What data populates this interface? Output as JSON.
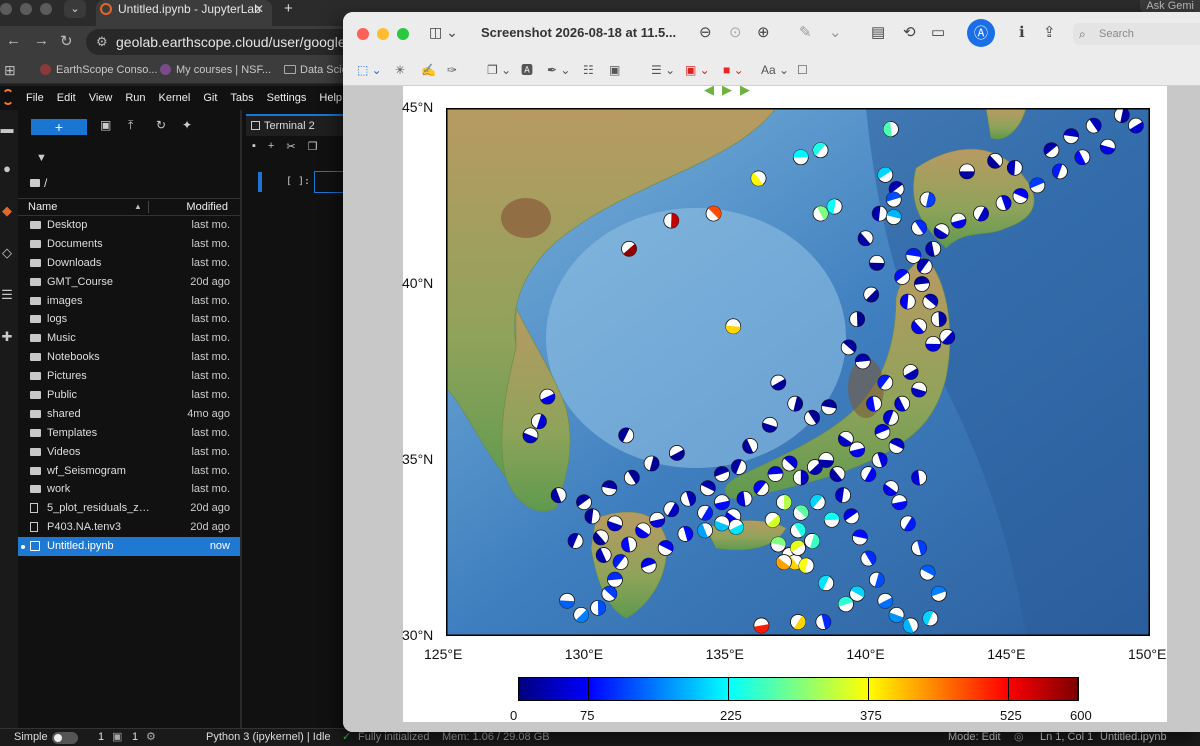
{
  "browser": {
    "tab_title": "Untitled.ipynb - JupyterLab",
    "url": "geolab.earthscope.cloud/user/google-oauth",
    "ask": "Ask Gemi",
    "bookmarks": [
      {
        "label": "EarthScope Conso..."
      },
      {
        "label": "My courses | NSF..."
      },
      {
        "label": "Data Scie"
      }
    ]
  },
  "jupyter": {
    "menu": [
      "File",
      "Edit",
      "View",
      "Run",
      "Kernel",
      "Git",
      "Tabs",
      "Settings",
      "Help"
    ],
    "new_label": "+",
    "crumb": "/",
    "col_name": "Name",
    "col_modified": "Modified",
    "files": [
      {
        "name": "Desktop",
        "modified": "last mo.",
        "type": "folder"
      },
      {
        "name": "Documents",
        "modified": "last mo.",
        "type": "folder"
      },
      {
        "name": "Downloads",
        "modified": "last mo.",
        "type": "folder"
      },
      {
        "name": "GMT_Course",
        "modified": "20d ago",
        "type": "folder"
      },
      {
        "name": "images",
        "modified": "last mo.",
        "type": "folder"
      },
      {
        "name": "logs",
        "modified": "last mo.",
        "type": "folder"
      },
      {
        "name": "Music",
        "modified": "last mo.",
        "type": "folder"
      },
      {
        "name": "Notebooks",
        "modified": "last mo.",
        "type": "folder"
      },
      {
        "name": "Pictures",
        "modified": "last mo.",
        "type": "folder"
      },
      {
        "name": "Public",
        "modified": "last mo.",
        "type": "folder"
      },
      {
        "name": "shared",
        "modified": "4mo ago",
        "type": "folder"
      },
      {
        "name": "Templates",
        "modified": "last mo.",
        "type": "folder"
      },
      {
        "name": "Videos",
        "modified": "last mo.",
        "type": "folder"
      },
      {
        "name": "wf_Seismogram",
        "modified": "last mo.",
        "type": "folder"
      },
      {
        "name": "work",
        "modified": "last mo.",
        "type": "folder"
      },
      {
        "name": "5_plot_residuals_zo...",
        "modified": "20d ago",
        "type": "file"
      },
      {
        "name": "P403.NA.tenv3",
        "modified": "20d ago",
        "type": "file"
      },
      {
        "name": "Untitled.ipynb",
        "modified": "now",
        "type": "notebook",
        "selected": true
      }
    ],
    "tab_label": "Terminal 2",
    "cell_prompt": "[ ]:"
  },
  "status": {
    "mode_label": "Simple",
    "count1": "1",
    "count2": "1",
    "kernel": "Python 3 (ipykernel) | Idle",
    "init": "Fully initialized",
    "mem": "Mem: 1.06 / 29.08 GB",
    "edit_mode": "Mode: Edit",
    "position": "Ln 1, Col 1",
    "filename": "Untitled.ipynb"
  },
  "preview": {
    "title": "Screenshot 2026-08-18 at 11.5...",
    "search_placeholder": "Search",
    "traffic_colors": [
      "#fe5f57",
      "#febc2e",
      "#28c840"
    ]
  },
  "chart_data": {
    "type": "scatter",
    "title": "",
    "xlim": [
      125,
      150
    ],
    "ylim": [
      30,
      45
    ],
    "x_ticks": [
      "125°E",
      "130°E",
      "135°E",
      "140°E",
      "145°E",
      "150°E"
    ],
    "y_ticks": [
      "30°N",
      "35°N",
      "40°N",
      "45°N"
    ],
    "colorbar": {
      "ticks": [
        "0",
        "75",
        "225",
        "375",
        "525",
        "600"
      ],
      "range": [
        0,
        600
      ],
      "colormap": "jet"
    },
    "series": [
      {
        "points": [
          [
            143.5,
            43.2,
            20
          ],
          [
            144.5,
            43.5,
            15
          ],
          [
            145.2,
            43.3,
            30
          ],
          [
            146.5,
            43.8,
            25
          ],
          [
            147.2,
            44.2,
            40
          ],
          [
            148.0,
            44.5,
            35
          ],
          [
            149.0,
            44.8,
            20
          ],
          [
            149.5,
            44.5,
            45
          ],
          [
            148.5,
            43.9,
            60
          ],
          [
            147.6,
            43.6,
            80
          ],
          [
            146.8,
            43.2,
            90
          ],
          [
            146.0,
            42.8,
            110
          ],
          [
            145.4,
            42.5,
            70
          ],
          [
            144.8,
            42.3,
            50
          ],
          [
            144.0,
            42.0,
            40
          ],
          [
            143.2,
            41.8,
            60
          ],
          [
            142.6,
            41.5,
            35
          ],
          [
            142.3,
            41.0,
            25
          ],
          [
            142.0,
            40.5,
            30
          ],
          [
            141.9,
            40.0,
            20
          ],
          [
            142.2,
            39.5,
            30
          ],
          [
            142.5,
            39.0,
            25
          ],
          [
            142.8,
            38.5,
            40
          ],
          [
            142.3,
            38.3,
            50
          ],
          [
            141.8,
            38.8,
            60
          ],
          [
            141.4,
            39.5,
            70
          ],
          [
            141.2,
            40.2,
            80
          ],
          [
            141.6,
            40.8,
            90
          ],
          [
            141.8,
            41.6,
            100
          ],
          [
            142.1,
            42.4,
            110
          ],
          [
            141.5,
            37.5,
            30
          ],
          [
            141.8,
            37.0,
            35
          ],
          [
            141.2,
            36.6,
            45
          ],
          [
            140.8,
            36.2,
            50
          ],
          [
            140.5,
            35.8,
            60
          ],
          [
            141.0,
            35.4,
            40
          ],
          [
            140.4,
            35.0,
            55
          ],
          [
            140.0,
            34.6,
            70
          ],
          [
            139.6,
            35.3,
            65
          ],
          [
            139.2,
            35.6,
            40
          ],
          [
            140.2,
            36.6,
            80
          ],
          [
            140.6,
            37.2,
            90
          ],
          [
            139.8,
            37.8,
            20
          ],
          [
            139.3,
            38.2,
            15
          ],
          [
            139.6,
            39.0,
            10
          ],
          [
            140.1,
            39.7,
            12
          ],
          [
            140.3,
            40.6,
            15
          ],
          [
            139.9,
            41.3,
            20
          ],
          [
            140.4,
            42.0,
            25
          ],
          [
            141.0,
            42.7,
            30
          ],
          [
            138.6,
            36.5,
            15
          ],
          [
            138.0,
            36.2,
            10
          ],
          [
            137.4,
            36.6,
            12
          ],
          [
            136.8,
            37.2,
            15
          ],
          [
            136.5,
            36.0,
            20
          ],
          [
            135.8,
            35.4,
            14
          ],
          [
            135.4,
            34.8,
            18
          ],
          [
            134.8,
            34.6,
            20
          ],
          [
            134.3,
            34.2,
            25
          ],
          [
            133.6,
            33.9,
            30
          ],
          [
            133.0,
            33.6,
            40
          ],
          [
            132.5,
            33.3,
            50
          ],
          [
            132.0,
            33.0,
            60
          ],
          [
            131.5,
            32.6,
            80
          ],
          [
            131.2,
            32.1,
            90
          ],
          [
            131.0,
            31.6,
            100
          ],
          [
            130.8,
            31.2,
            110
          ],
          [
            130.4,
            30.8,
            120
          ],
          [
            129.8,
            30.6,
            150
          ],
          [
            129.3,
            31.0,
            130
          ],
          [
            130.5,
            32.8,
            15
          ],
          [
            130.2,
            33.4,
            12
          ],
          [
            129.9,
            33.8,
            20
          ],
          [
            130.8,
            34.2,
            18
          ],
          [
            131.6,
            34.5,
            14
          ],
          [
            132.3,
            34.9,
            12
          ],
          [
            133.2,
            35.2,
            15
          ],
          [
            131.0,
            33.2,
            40
          ],
          [
            130.6,
            32.3,
            30
          ],
          [
            129.6,
            32.7,
            25
          ],
          [
            132.2,
            32.0,
            60
          ],
          [
            132.8,
            32.5,
            70
          ],
          [
            133.5,
            32.9,
            80
          ],
          [
            134.2,
            33.5,
            90
          ],
          [
            134.8,
            33.8,
            80
          ],
          [
            135.2,
            33.4,
            60
          ],
          [
            135.6,
            33.9,
            50
          ],
          [
            136.2,
            34.2,
            70
          ],
          [
            136.7,
            34.6,
            60
          ],
          [
            137.2,
            34.9,
            50
          ],
          [
            137.6,
            34.5,
            40
          ],
          [
            138.1,
            34.8,
            30
          ],
          [
            138.5,
            35.0,
            25
          ],
          [
            138.9,
            34.6,
            20
          ],
          [
            139.1,
            34.0,
            40
          ],
          [
            139.4,
            33.4,
            60
          ],
          [
            139.7,
            32.8,
            80
          ],
          [
            140.0,
            32.2,
            100
          ],
          [
            140.3,
            31.6,
            120
          ],
          [
            140.6,
            31.0,
            140
          ],
          [
            141.0,
            30.6,
            160
          ],
          [
            141.5,
            30.3,
            180
          ],
          [
            142.2,
            30.5,
            200
          ],
          [
            142.5,
            31.2,
            150
          ],
          [
            142.1,
            31.8,
            130
          ],
          [
            141.8,
            32.5,
            110
          ],
          [
            141.4,
            33.2,
            90
          ],
          [
            141.1,
            33.8,
            80
          ],
          [
            140.8,
            34.2,
            60
          ],
          [
            141.8,
            34.5,
            50
          ],
          [
            138.2,
            33.8,
            200
          ],
          [
            138.7,
            33.3,
            230
          ],
          [
            137.6,
            33.5,
            280
          ],
          [
            137.0,
            33.8,
            330
          ],
          [
            136.6,
            33.3,
            350
          ],
          [
            137.2,
            32.3,
            390
          ],
          [
            137.4,
            32.1,
            400
          ],
          [
            137.8,
            32.0,
            370
          ],
          [
            137.5,
            32.5,
            360
          ],
          [
            136.8,
            32.6,
            300
          ],
          [
            137.5,
            33.0,
            240
          ],
          [
            138.0,
            32.7,
            260
          ],
          [
            135.3,
            33.1,
            210
          ],
          [
            134.8,
            33.2,
            190
          ],
          [
            134.2,
            33.0,
            170
          ],
          [
            138.5,
            31.5,
            210
          ],
          [
            139.2,
            30.9,
            250
          ],
          [
            139.6,
            31.2,
            200
          ],
          [
            138.4,
            30.4,
            100
          ],
          [
            137.5,
            30.4,
            400
          ],
          [
            136.2,
            30.3,
            510
          ],
          [
            137.0,
            32.1,
            430
          ],
          [
            140.8,
            44.4,
            270
          ],
          [
            138.3,
            43.8,
            240
          ],
          [
            137.6,
            43.6,
            220
          ],
          [
            134.5,
            42.0,
            480
          ],
          [
            133.0,
            41.8,
            560
          ],
          [
            131.5,
            41.0,
            590
          ],
          [
            135.2,
            38.8,
            400
          ],
          [
            136.1,
            43.0,
            380
          ],
          [
            138.8,
            42.2,
            230
          ],
          [
            140.6,
            43.1,
            200
          ],
          [
            140.9,
            41.9,
            180
          ],
          [
            138.3,
            42.0,
            300
          ],
          [
            128.3,
            36.1,
            50
          ],
          [
            128.6,
            36.8,
            60
          ],
          [
            128.0,
            35.7,
            40
          ],
          [
            129.0,
            34.0,
            20
          ],
          [
            131.4,
            35.7,
            15
          ],
          [
            140.9,
            42.4,
            120
          ]
        ]
      }
    ]
  }
}
